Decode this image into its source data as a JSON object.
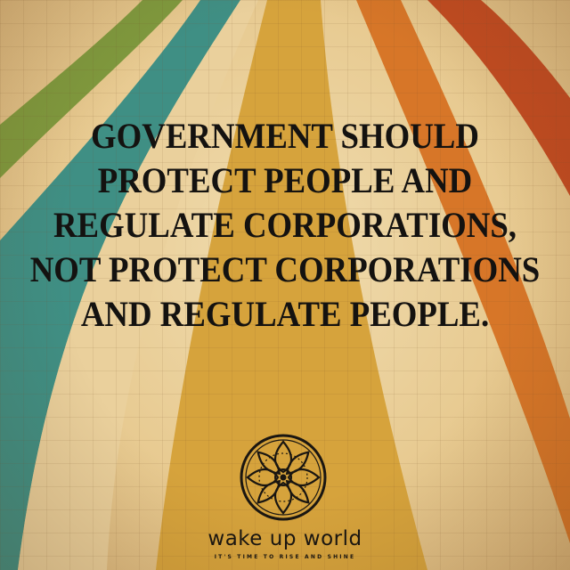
{
  "headline": {
    "line1": "GOVERNMENT SHOULD",
    "line2": "PROTECT PEOPLE AND",
    "line3": "REGULATE CORPORATIONS,",
    "line4": "NOT PROTECT CORPORATIONS",
    "line5": "AND REGULATE PEOPLE."
  },
  "branding": {
    "name": "wake up world",
    "tagline": "IT'S TIME TO RISE AND SHINE",
    "logo_icon": "mandala-icon"
  },
  "colors": {
    "background": "#ebd3a1",
    "ray_green": "#7f9a3e",
    "ray_teal": "#3f8f84",
    "ray_gold": "#d6a33c",
    "ray_orange": "#d77628",
    "ray_red": "#c24b21",
    "text": "#141210"
  }
}
